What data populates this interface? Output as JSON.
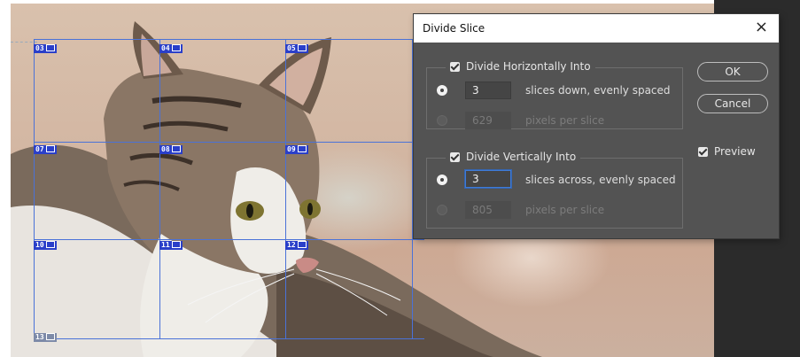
{
  "dialog": {
    "title": "Divide Slice",
    "close_glyph": "×",
    "horizontal": {
      "label": "Divide Horizontally Into",
      "checked": true,
      "slices_value": "3",
      "slices_label": "slices down, evenly spaced",
      "pixels_value": "629",
      "pixels_label": "pixels per slice",
      "selected_option": "slices"
    },
    "vertical": {
      "label": "Divide Vertically Into",
      "checked": true,
      "slices_value": "3",
      "slices_label": "slices across, evenly spaced",
      "pixels_value": "805",
      "pixels_label": "pixels per slice",
      "selected_option": "slices"
    },
    "ok_label": "OK",
    "cancel_label": "Cancel",
    "preview": {
      "label": "Preview",
      "checked": true
    }
  },
  "slice_tags": [
    "03",
    "04",
    "05",
    "07",
    "08",
    "09",
    "10",
    "11",
    "12",
    "13"
  ],
  "colors": {
    "slice_line": "#4a72d8",
    "slice_tag_bg": "#2a3fc9",
    "dialog_bg": "#535353",
    "focus_ring": "#3f7bd6"
  }
}
